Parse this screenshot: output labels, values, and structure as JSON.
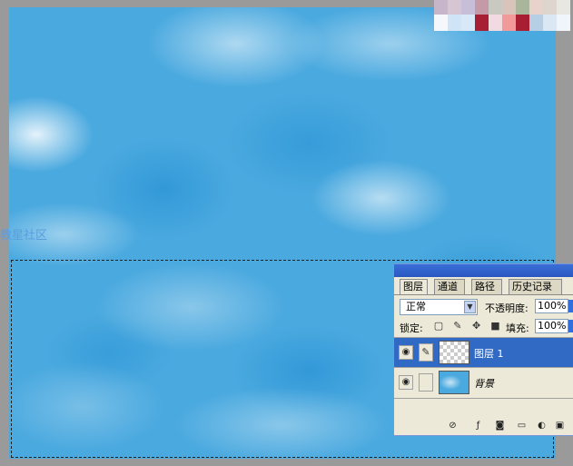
{
  "watermark": "教星社区",
  "swatches": {
    "row1": [
      "#c7b6c9",
      "#d6c6d4",
      "#c7bfd8",
      "#c49aa9",
      "#c8c9c1",
      "#d9c4bc",
      "#aab69c",
      "#e9d2cb",
      "#ddd6ce",
      "#e9e7e2"
    ],
    "row2": [
      "#f5f8fb",
      "#cfe4f6",
      "#d8e8f6",
      "#a81f34",
      "#f2dbe0",
      "#f29a9a",
      "#a81f34",
      "#b6cfe5",
      "#dbe8f4",
      "#eff5fa"
    ]
  },
  "layers_panel": {
    "tabs": [
      "图层",
      "通道",
      "路径",
      "历史记录"
    ],
    "blend_mode": "正常",
    "opacity_label": "不透明度:",
    "opacity_value": "100%",
    "lock_label": "锁定:",
    "lock_icons": [
      "lock-transparent-icon",
      "lock-brush-icon",
      "lock-move-icon",
      "lock-all-icon"
    ],
    "fill_label": "填充:",
    "fill_value": "100%",
    "layers": [
      {
        "name": "图层 1",
        "selected": true,
        "thumbnail": "transparent"
      },
      {
        "name": "背景",
        "selected": false,
        "thumbnail": "clouds"
      }
    ],
    "bottom_icons": [
      "link-layers-icon",
      "layer-style-icon",
      "add-mask-icon",
      "new-group-icon",
      "adjustment-layer-icon",
      "new-layer-icon"
    ]
  }
}
